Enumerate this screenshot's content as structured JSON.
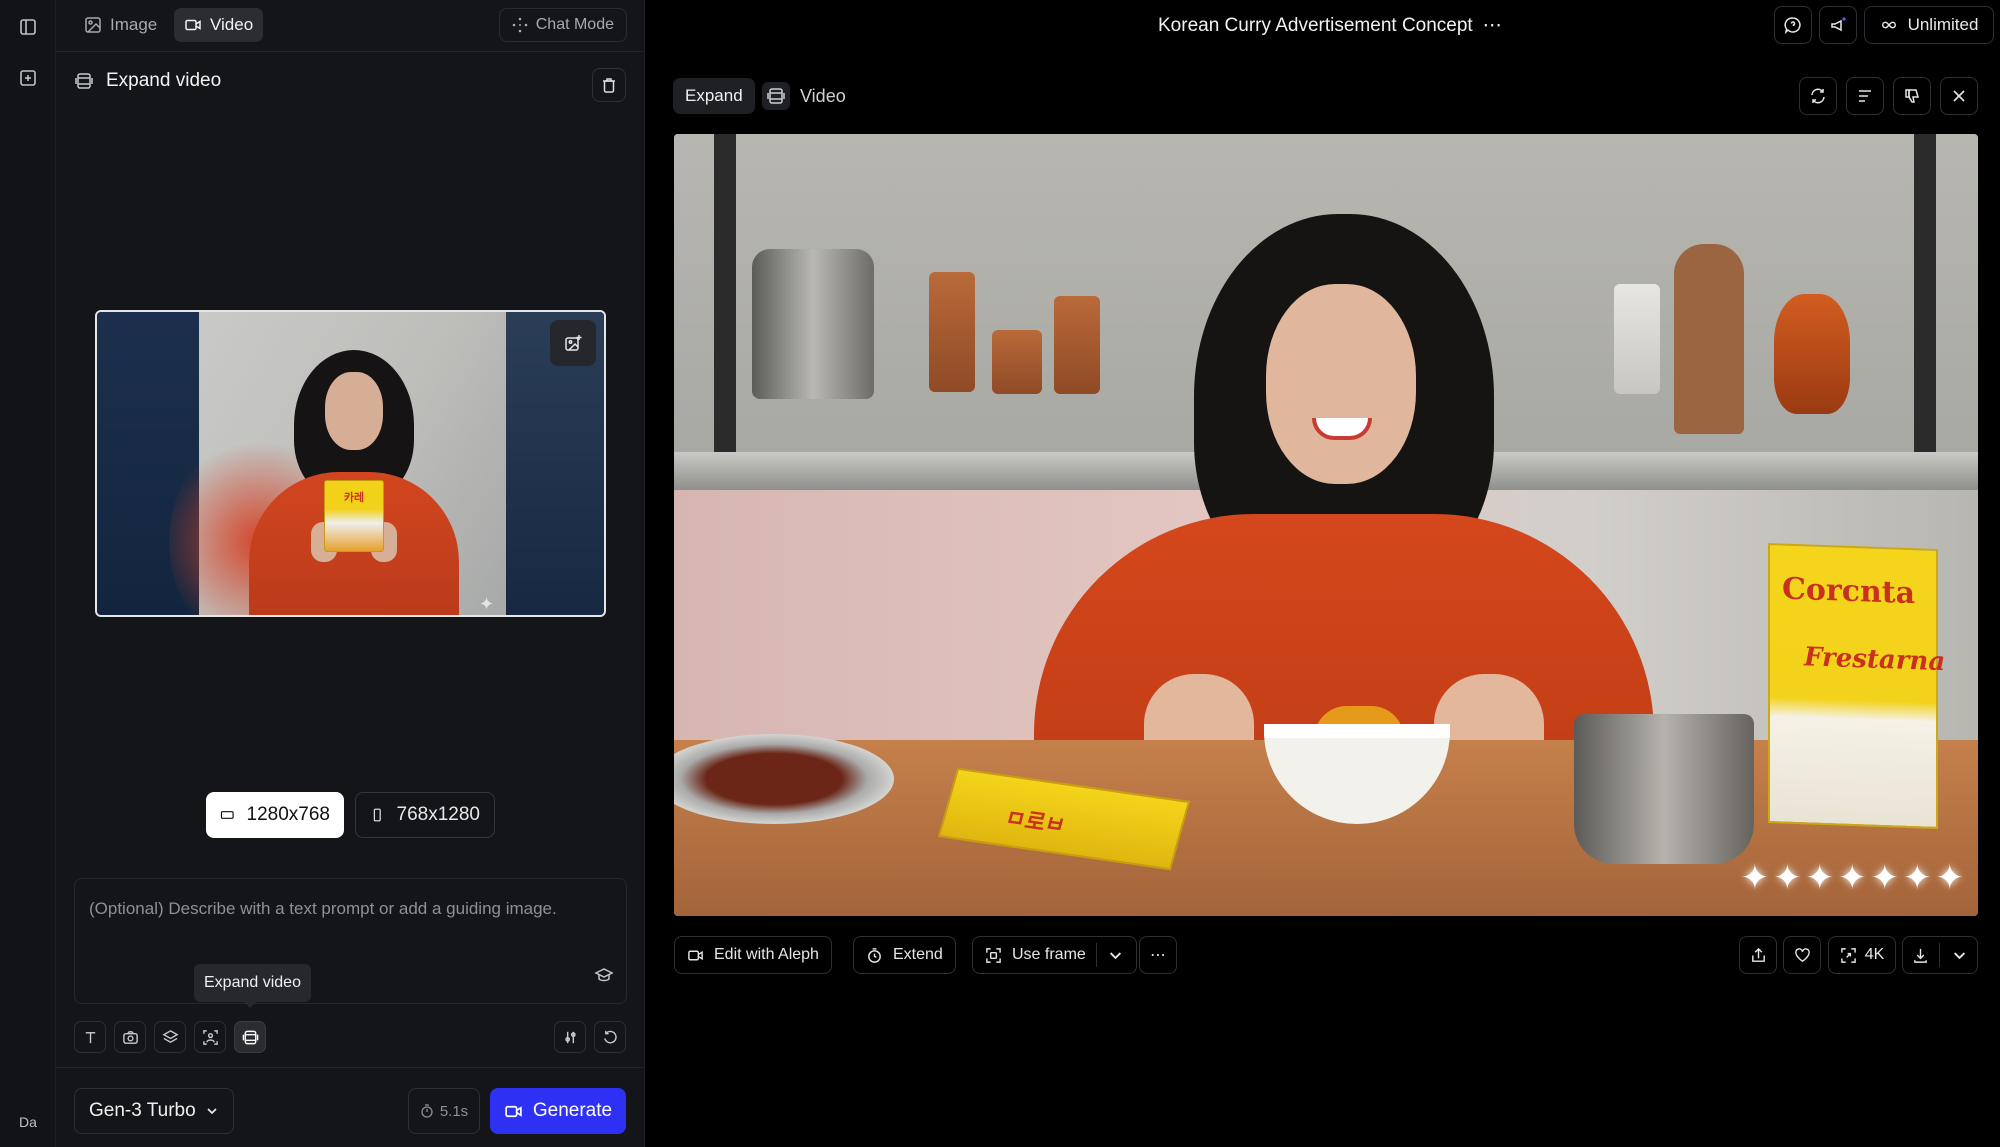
{
  "rail": {
    "user_initials": "Da"
  },
  "panel": {
    "tabs": [
      {
        "label": "Image",
        "icon": "image-icon"
      },
      {
        "label": "Video",
        "icon": "video-icon"
      }
    ],
    "chat_mode_label": "Chat Mode",
    "header_title": "Expand video",
    "resolutions": [
      "1280x768",
      "768x1280"
    ],
    "selected_resolution": "1280x768",
    "prompt_placeholder": "(Optional) Describe with a text prompt or add a guiding image.",
    "tooltip": "Expand video",
    "model_label": "Gen-3 Turbo",
    "duration_label": "5.1s",
    "generate_label": "Generate",
    "preview_box_text": "카레"
  },
  "main": {
    "title": "Korean Curry Advertisement Concept",
    "unlimited_label": "Unlimited",
    "expand_badge": "Expand",
    "video_label": "Video",
    "actions": {
      "edit": "Edit with Aleph",
      "extend": "Extend",
      "use_frame": "Use frame",
      "quality": "4K"
    },
    "product_text_1": "Corcnta",
    "product_text_2": "Frestarna",
    "table_box_text": "ㅁ로ㅂ"
  },
  "colors": {
    "accent": "#2e31f3",
    "panel_bg": "#141518",
    "bg": "#000000"
  }
}
